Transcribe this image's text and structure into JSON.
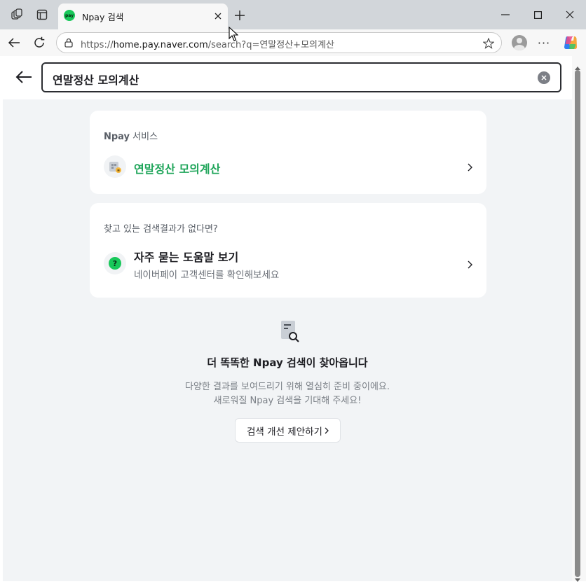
{
  "browser": {
    "tab": {
      "title": "Npay 검색",
      "favicon_text": "pay"
    },
    "address": {
      "prefix": "https://",
      "host": "home.pay.naver.com",
      "rest": "/search?q=연말정산+모의계산"
    }
  },
  "search": {
    "query": "연말정산 모의계산"
  },
  "services_card": {
    "label_brand": "Npay",
    "label_rest": " 서비스",
    "link_text": "연말정산 모의계산"
  },
  "help_card": {
    "label": "찾고 있는 검색결과가 없다면?",
    "title": "자주 묻는 도움말 보기",
    "subtitle": "네이버페이 고객센터를 확인해보세요"
  },
  "empty_state": {
    "title_prefix": "더 똑똑한 ",
    "title_brand": "Npay",
    "title_suffix": " 검색이 찾아옵니다",
    "desc_line1": "다양한 결과를 보여드리기 위해 열심히 준비 중이에요.",
    "desc_line2": "새로워질 Npay 검색을 기대해 주세요!",
    "button_label": "검색 개선 제안하기"
  },
  "colors": {
    "accent_green": "#1fa55a",
    "naver_green": "#18c85a",
    "page_bg": "#f2f4f6"
  }
}
